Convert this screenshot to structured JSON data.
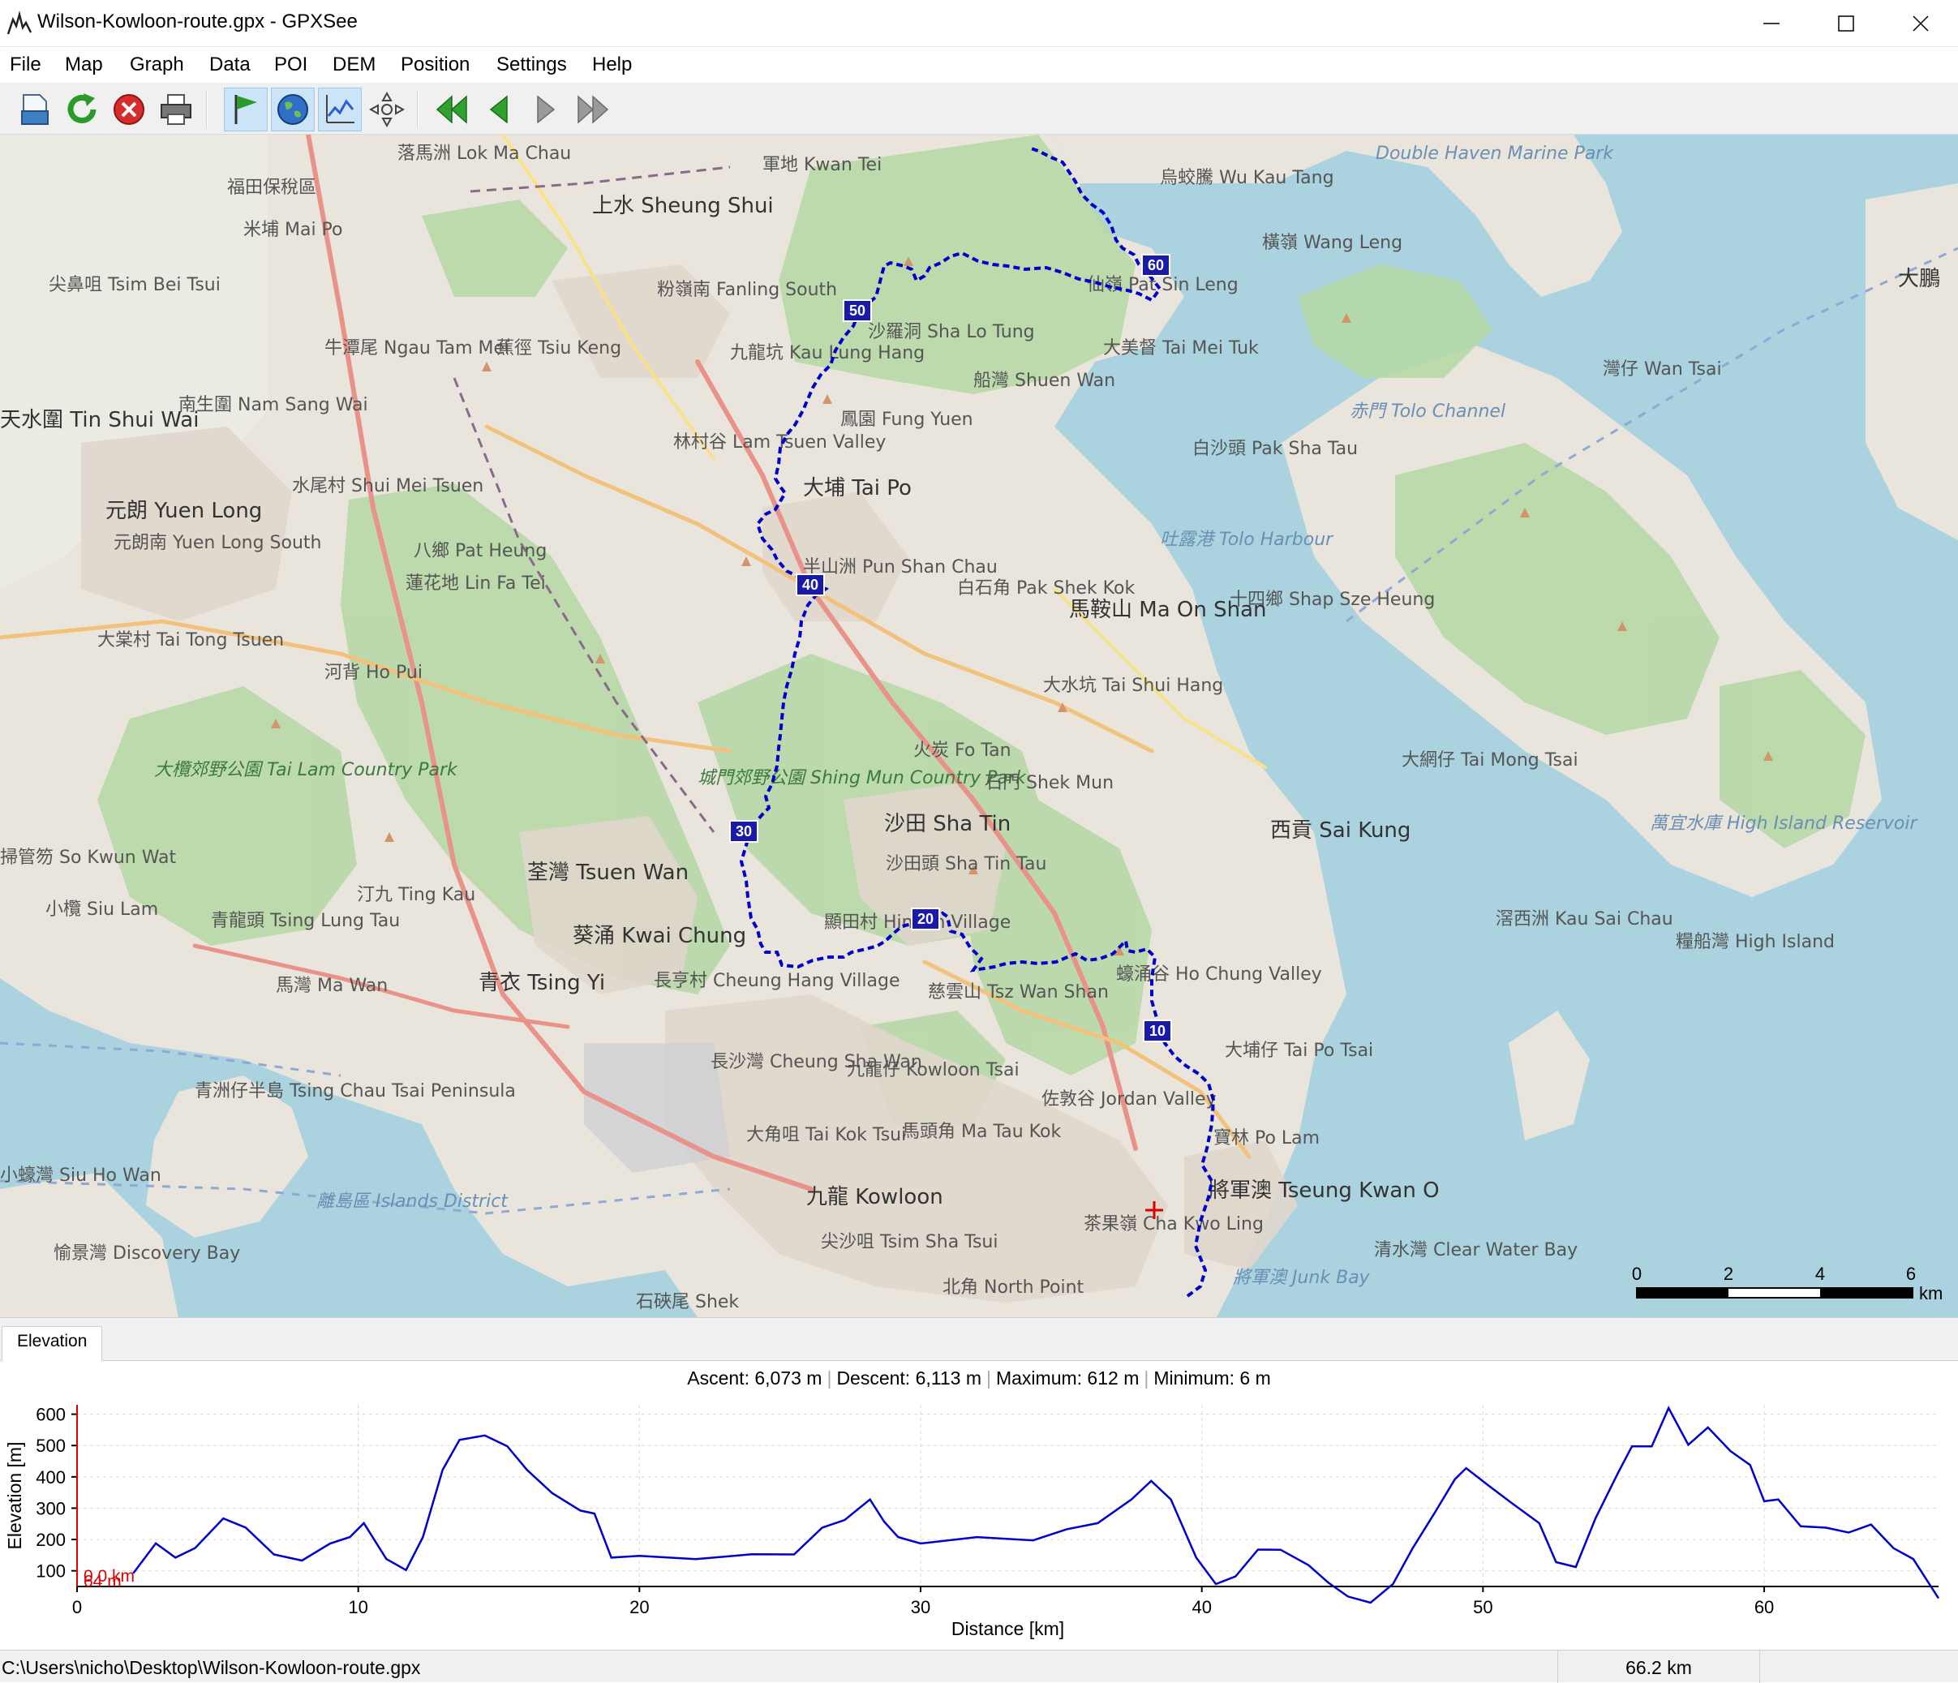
{
  "window": {
    "title": "Wilson-Kowloon-route.gpx - GPXSee",
    "minimize_icon": "minimize-icon",
    "maximize_icon": "maximize-icon",
    "close_icon": "close-icon"
  },
  "menu": [
    "File",
    "Map",
    "Graph",
    "Data",
    "POI",
    "DEM",
    "Position",
    "Settings",
    "Help"
  ],
  "toolbar": {
    "buttons": [
      "open-file-icon",
      "reload-icon",
      "close-file-icon",
      "print-icon",
      "show-waypoints-icon",
      "show-map-icon",
      "show-graphs-icon",
      "position-icon",
      "first-file-icon",
      "previous-file-icon",
      "next-file-icon",
      "last-file-icon"
    ],
    "active": [
      "show-waypoints-icon",
      "show-map-icon",
      "show-graphs-icon"
    ]
  },
  "map": {
    "route_color": "#0000cc",
    "km_markers": [
      "10",
      "20",
      "30",
      "40",
      "50",
      "60"
    ],
    "labels": {
      "lok_ma_chau": "落馬洲 Lok Ma Chau",
      "kwu_tung": "軍地 Kwan Tei",
      "sheung_shui": "上水 Sheung Shui",
      "fanling": "粉嶺南 Fanling South",
      "mai_po": "米埔 Mai Po",
      "tsim_bei_tsui": "尖鼻咀 Tsim Bei Tsui",
      "futian": "福田保稅區",
      "ngau_tam_mei": "牛潭尾 Ngau Tam Mei",
      "tsiu_keng": "蕉徑 Tsiu Keng",
      "tin_shui_wai": "天水圍 Tin Shui Wai",
      "nam_sang_wai": "南生圍 Nam Sang Wai",
      "yuen_long": "元朗 Yuen Long",
      "yuen_long_south": "元朗南 Yuen Long South",
      "shui_mei_tsuen": "水尾村 Shui Mei Tsuen",
      "pat_heung": "八鄉 Pat Heung",
      "lin_fa_tei": "蓮花地 Lin Fa Tei",
      "tai_tong": "大棠村 Tai Tong Tsuen",
      "ho_pui": "河背 Ho Pui",
      "tai_lam": "大欖郊野公園 Tai Lam Country Park",
      "so_kwun_wat": "掃管笏 So Kwun Wat",
      "siu_lam": "小欖 Siu Lam",
      "tsing_lung_tau": "青龍頭 Tsing Lung Tau",
      "ting_kau": "汀九 Ting Kau",
      "tsuen_wan": "荃灣 Tsuen Wan",
      "kwai_chung": "葵涌 Kwai Chung",
      "tsing_yi": "青衣 Tsing Yi",
      "ma_wan": "馬灣 Ma Wan",
      "cheung_hang": "長亨村 Cheung Hang Village",
      "tsing_chau_tsai": "青洲仔半島 Tsing Chau Tsai Peninsula",
      "siu_ho_wan": "小蠔灣 Siu Ho Wan",
      "discovery_bay": "愉景灣 Discovery Bay",
      "islands": "離島區 Islands District",
      "shing_mun": "城門郊野公園 Shing Mun Country Park",
      "kau_lung_hang": "九龍坑 Kau Lung Hang",
      "lam_tsuen": "林村谷 Lam Tsuen Valley",
      "tai_po": "大埔 Tai Po",
      "pun_chun": "半山洲 Pun Shan Chau",
      "fung_yuen": "鳳園 Fung Yuen",
      "sha_lo_tung": "沙羅洞 Sha Lo Tung",
      "shuen_wan": "船灣 Shuen Wan",
      "sin_leng": "仙嶺 Pat Sin Leng",
      "wu_kau_tang": "烏蛟騰 Wu Kau Tang",
      "wang_leng": "橫嶺 Wang Leng",
      "double_haven": "Double Haven Marine Park",
      "tai_mei_tuk": "大美督 Tai Mei Tuk",
      "pak_sha_tau": "白沙頭 Pak Sha Tau",
      "tolo_harbour": "吐露港 Tolo Harbour",
      "tolo_channel": "赤門 Tolo Channel",
      "wan_tsai": "灣仔 Wan Tsai",
      "shek_kok": "白石角 Pak Shek Kok",
      "ma_on_shan": "馬鞍山 Ma On Shan",
      "shap_sze_heung": "十四鄉 Shap Sze Heung",
      "tai_shui_hang": "大水坑 Tai Shui Hang",
      "fo_tan": "火炭 Fo Tan",
      "shek_mun": "石門 Shek Mun",
      "sha_tin": "沙田 Sha Tin",
      "sha_tin_tau": "沙田頭 Sha Tin Tau",
      "hin_tin": "顯田村 Hin Tin Village",
      "tsz_wan_shan": "慈雲山 Tsz Wan Shan",
      "ho_chung": "蠔涌谷 Ho Chung Valley",
      "tai_mong_tsai": "大網仔 Tai Mong Tsai",
      "sai_kung": "西貢 Sai Kung",
      "high_island": "糧船灣 High Island",
      "high_island_res": "萬宜水庫 High Island Reservoir",
      "kau_sai_chau": "滘西洲 Kau Sai Chau",
      "tai_po_tsai": "大埔仔 Tai Po Tsai",
      "po_lam": "寶林 Po Lam",
      "tseung_kwan_o": "將軍澳 Tseung Kwan O",
      "clear_water_bay": "清水灣 Clear Water Bay",
      "junk_bay": "將軍澳 Junk Bay",
      "jordan_valley": "佐敦谷 Jordan Valley",
      "kowloon_tsai": "九龍仔 Kowloon Tsai",
      "cheung_sha_wan": "長沙灣 Cheung Sha Wan",
      "tai_kok_tsui": "大角咀 Tai Kok Tsui",
      "ma_tau_kok": "馬頭角 Ma Tau Kok",
      "kowloon": "九龍 Kowloon",
      "tsim_sha_tsui": "尖沙咀 Tsim Sha Tsui",
      "north_point": "北角 North Point",
      "shek_o": "石硤尾 Shek",
      "cha_kwo_ling": "茶果嶺 Cha Kwo Ling",
      "dapeng": "大鵬"
    },
    "scale": {
      "ticks": [
        "0",
        "2",
        "4",
        "6"
      ],
      "unit": "km"
    }
  },
  "elevation_tab": {
    "label": "Elevation"
  },
  "graph": {
    "info": {
      "ascent": "Ascent: 6,073 m",
      "descent": "Descent: 6,113 m",
      "maximum": "Maximum: 612 m",
      "minimum": "Minimum: 6 m"
    },
    "slider_elev": "64 m",
    "slider_dist": "0.0 km"
  },
  "chart_data": {
    "type": "line",
    "title": "",
    "xlabel": "Distance [km]",
    "ylabel": "Elevation [m]",
    "xlim": [
      0,
      66.2
    ],
    "ylim": [
      50,
      630
    ],
    "xticks": [
      "0",
      "10",
      "20",
      "30",
      "40",
      "50",
      "60"
    ],
    "yticks": [
      "100",
      "200",
      "300",
      "400",
      "500",
      "600"
    ],
    "grid": true,
    "series": [
      {
        "color": "#0000cc",
        "x": [
          2.0,
          2.8,
          3.5,
          4.2,
          5.2,
          6.0,
          7.0,
          8.0,
          9.0,
          9.7,
          10.2,
          11.0,
          11.7,
          12.3,
          13.0,
          13.6,
          14.5,
          15.3,
          16.0,
          16.9,
          17.9,
          18.4,
          19.0,
          20.0,
          22.0,
          24.0,
          25.5,
          26.5,
          27.3,
          28.2,
          28.7,
          29.2,
          30.0,
          32.0,
          34.0,
          35.2,
          36.3,
          37.5,
          38.2,
          38.9,
          39.8,
          40.5,
          41.2,
          42.0,
          42.8,
          43.8,
          44.5,
          45.2,
          46.0,
          46.8,
          47.5,
          48.3,
          49.0,
          49.4,
          50.2,
          51.0,
          52.0,
          52.6,
          53.3,
          54.0,
          54.8,
          55.3,
          56.0,
          56.6,
          57.3,
          58.0,
          58.8,
          59.5,
          60.0,
          60.5,
          61.3,
          62.2,
          63.0,
          63.8,
          64.6,
          65.3,
          66.2
        ],
        "y": [
          100,
          180,
          150,
          165,
          275,
          230,
          160,
          125,
          195,
          200,
          260,
          130,
          110,
          200,
          430,
          510,
          540,
          490,
          430,
          340,
          300,
          275,
          150,
          140,
          145,
          145,
          160,
          230,
          270,
          320,
          265,
          200,
          195,
          200,
          205,
          225,
          260,
          320,
          395,
          320,
          150,
          50,
          90,
          160,
          175,
          110,
          70,
          10,
          6,
          50,
          180,
          280,
          400,
          420,
          380,
          310,
          260,
          120,
          120,
          260,
          420,
          490,
          505,
          612,
          510,
          550,
          490,
          430,
          330,
          320,
          250,
          230,
          230,
          240,
          180,
          130,
          20
        ]
      }
    ]
  }
}
